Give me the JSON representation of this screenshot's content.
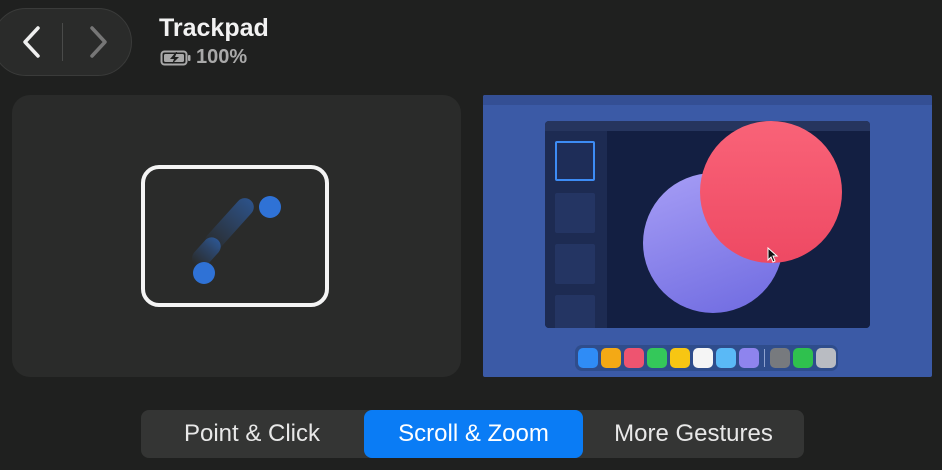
{
  "header": {
    "title": "Trackpad",
    "battery_level": "100%",
    "battery_icon": "battery-charging-icon"
  },
  "nav": {
    "back_icon": "chevron-left-icon",
    "forward_icon": "chevron-right-icon"
  },
  "tabs": [
    {
      "label": "Point & Click",
      "selected": false
    },
    {
      "label": "Scroll & Zoom",
      "selected": true
    },
    {
      "label": "More Gestures",
      "selected": false
    }
  ],
  "colors": {
    "accent": "#0a7cf5",
    "finger": "#2f72d6",
    "preview_background": "#3b5aa6",
    "purple_circle": "#8a7df0",
    "red_circle": "#f2506a"
  }
}
